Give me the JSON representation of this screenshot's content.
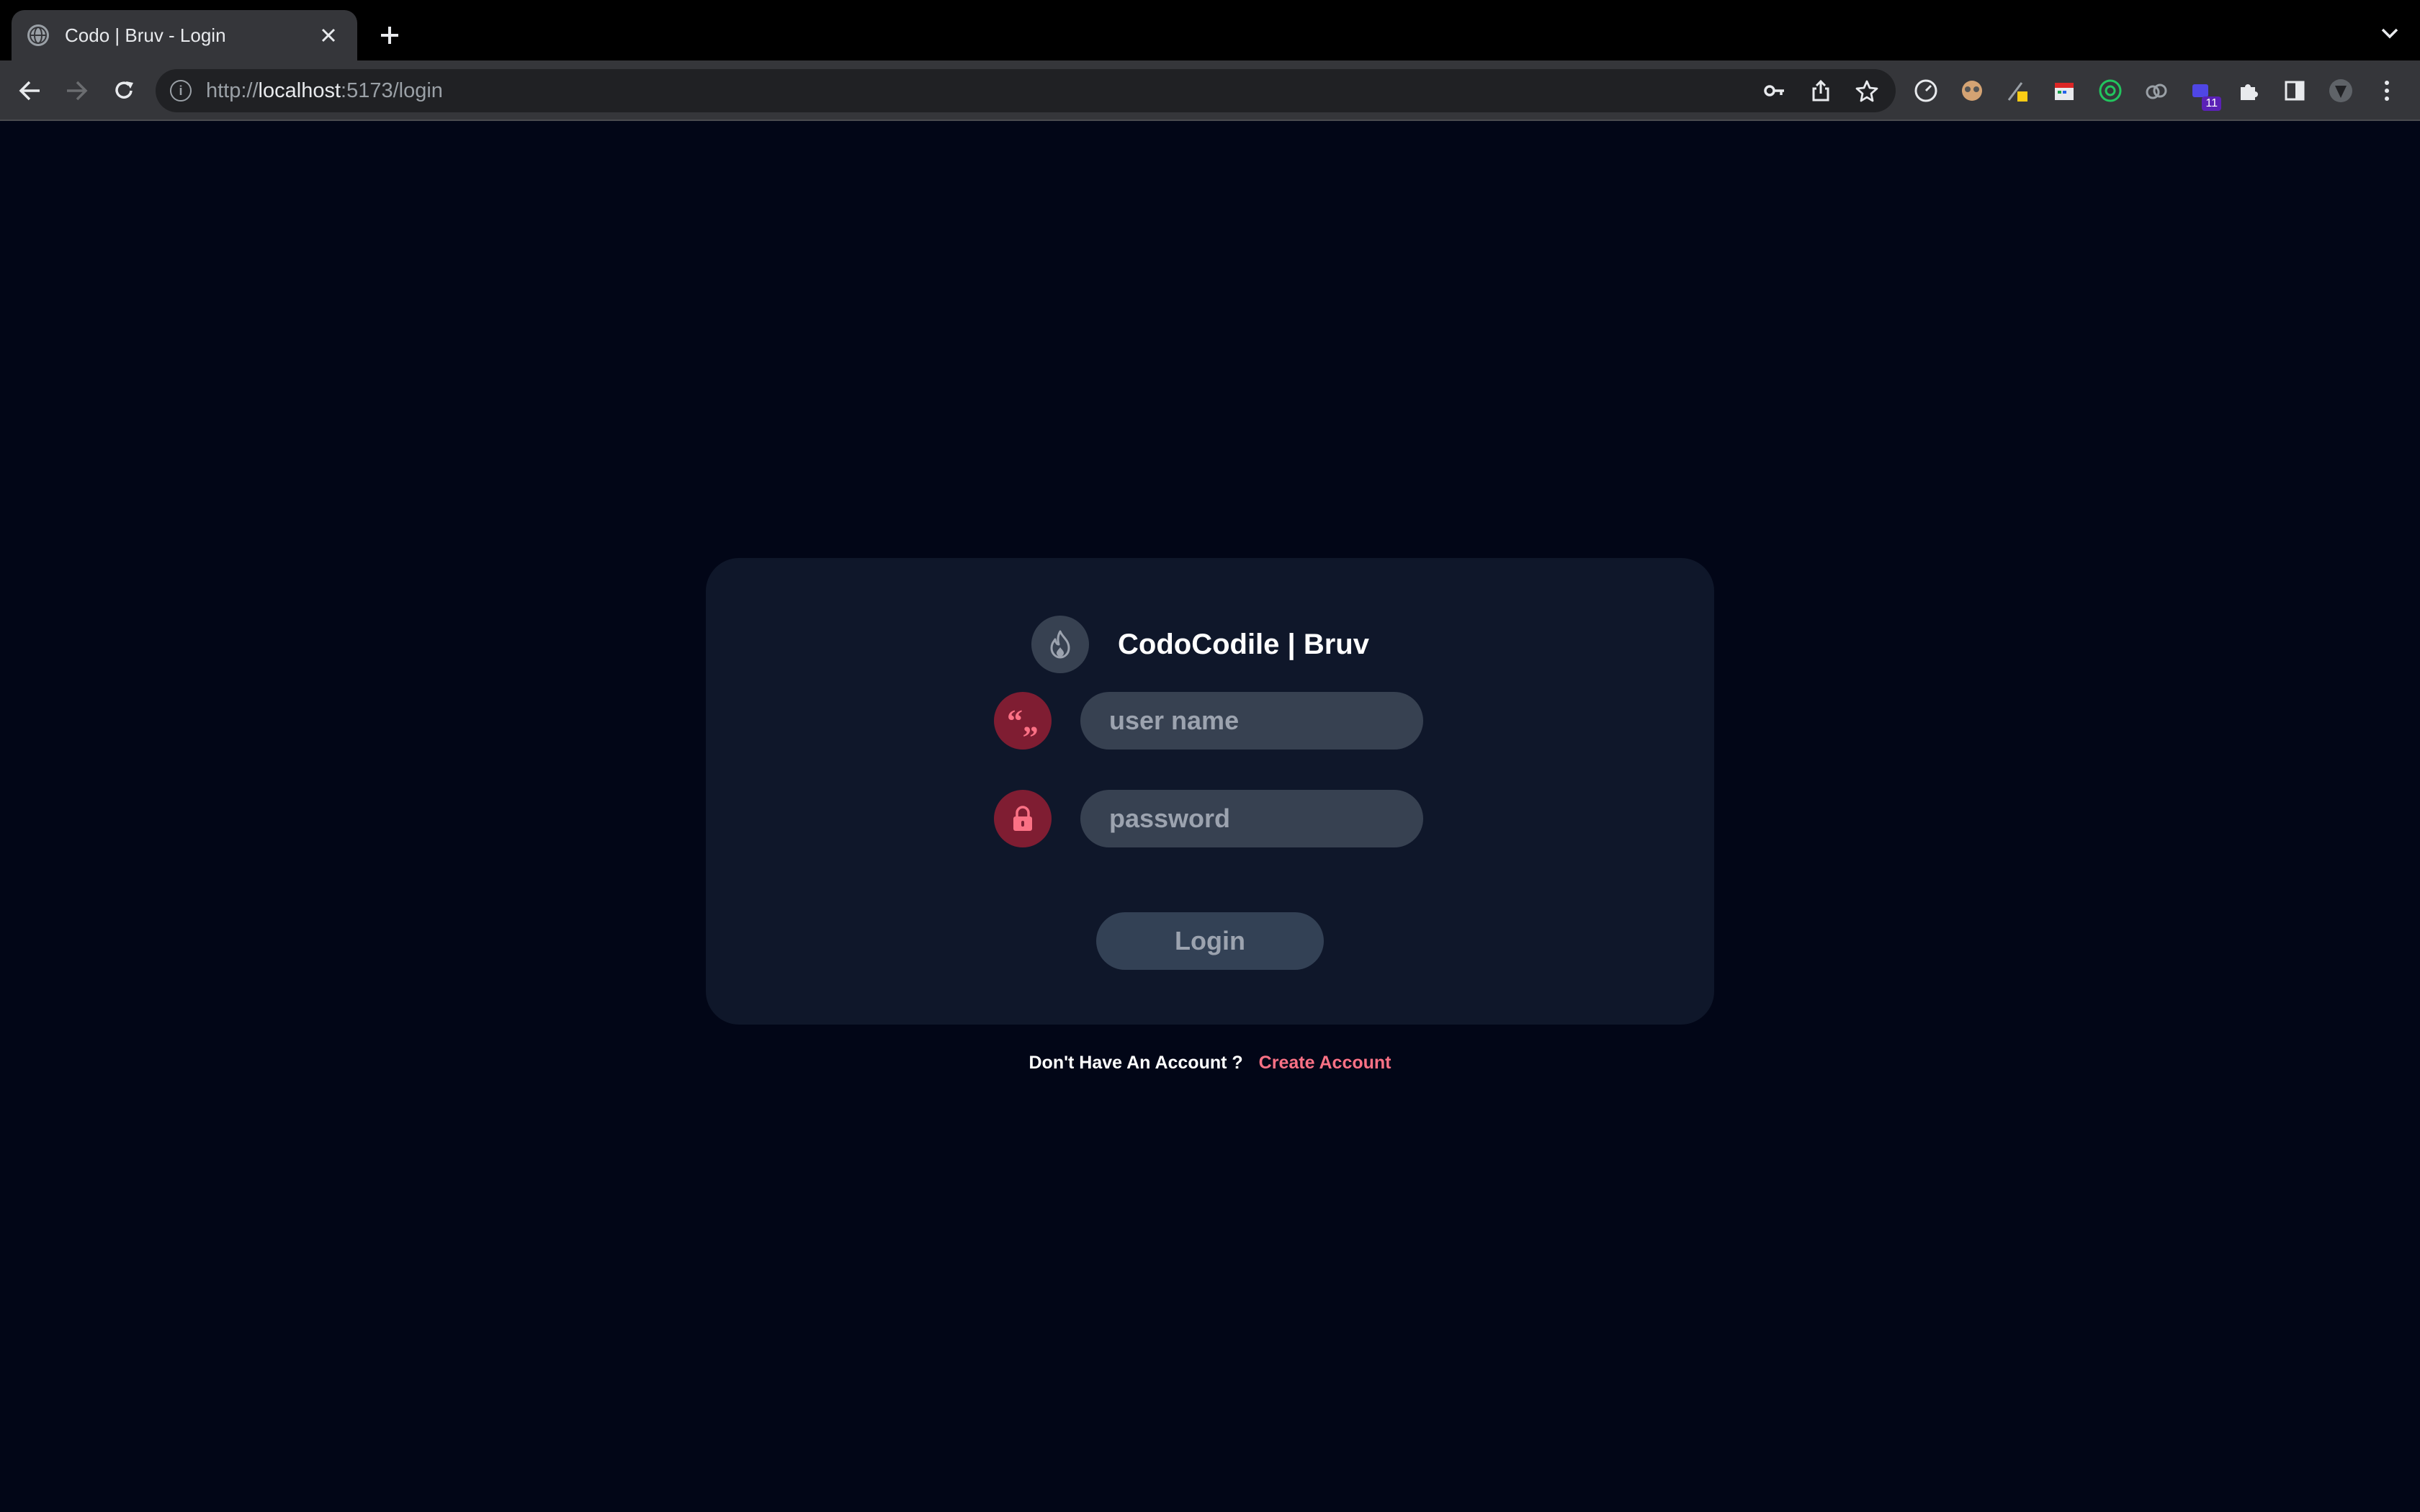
{
  "browser": {
    "tab_title": "Codo | Bruv - Login",
    "url_scheme": "http://",
    "url_host": "localhost",
    "url_rest": ":5173/login",
    "extension_badge": "11"
  },
  "login_card": {
    "brand_title": "CodoCodile | Bruv",
    "username_placeholder": "user name",
    "password_placeholder": "password",
    "login_label": "Login",
    "username_icon_glyph": "“„"
  },
  "footer": {
    "prompt": "Don't Have An Account ?",
    "create_account_label": "Create Account"
  },
  "colors": {
    "page_bg": "#020617",
    "card_bg": "#0f172a",
    "input_bg": "#374151",
    "icon_bg": "#7f1d32",
    "accent": "#fb7185"
  }
}
